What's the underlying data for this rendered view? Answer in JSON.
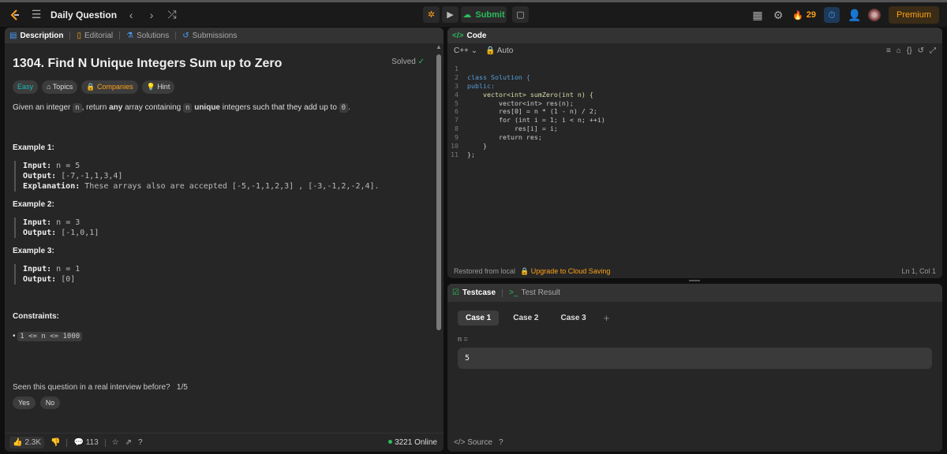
{
  "nav": {
    "title": "Daily Question",
    "submit_label": "Submit",
    "streak": "29",
    "premium_label": "Premium"
  },
  "desc_tabs": [
    "Description",
    "Editorial",
    "Solutions",
    "Submissions"
  ],
  "problem": {
    "title": "1304. Find N Unique Integers Sum up to Zero",
    "solved": "Solved",
    "chips": [
      "Easy",
      "Topics",
      "Companies",
      "Hint"
    ],
    "stmt": {
      "p1": "Given an integer ",
      "c1": "n",
      "p2": ", return ",
      "b1": "any",
      "p3": " array containing ",
      "c2": "n",
      "p4": " ",
      "b2": "unique",
      "p5": " integers such that they add up to ",
      "c3": "0",
      "p6": "."
    },
    "examples": [
      {
        "h": "Example 1:",
        "input_label": "Input:",
        "input": "n = 5",
        "output_label": "Output:",
        "output": "[-7,-1,1,3,4]",
        "expl_label": "Explanation:",
        "expl": "These arrays also are accepted [-5,-1,1,2,3] , [-3,-1,2,-2,4]."
      },
      {
        "h": "Example 2:",
        "input_label": "Input:",
        "input": "n = 3",
        "output_label": "Output:",
        "output": "[-1,0,1]"
      },
      {
        "h": "Example 3:",
        "input_label": "Input:",
        "input": "n = 1",
        "output_label": "Output:",
        "output": "[0]"
      }
    ],
    "constraints_h": "Constraints:",
    "constraint": "1 <= n <= 1000",
    "seen": "Seen this question in a real interview before?",
    "seen_count": "1/5",
    "yes": "Yes",
    "no": "No"
  },
  "desc_footer": {
    "likes": "2.3K",
    "comments": "113",
    "online": "3221 Online"
  },
  "code": {
    "tab": "Code",
    "lang": "C++",
    "auto": "Auto",
    "lines": [
      "",
      "class Solution {",
      "public:",
      "    vector<int> sumZero(int n) {",
      "        vector<int> res(n);",
      "        res[0] = n * (1 - n) / 2;",
      "        for (int i = 1; i < n; ++i)",
      "            res[i] = i;",
      "        return res;",
      "    }",
      "};"
    ],
    "restored": "Restored from local",
    "upgrade": "Upgrade to Cloud Saving",
    "position": "Ln 1, Col 1"
  },
  "test": {
    "tab1": "Testcase",
    "tab2": "Test Result",
    "cases": [
      "Case 1",
      "Case 2",
      "Case 3"
    ],
    "label": "n =",
    "value": "5",
    "source": "Source"
  },
  "colors": {
    "accent": "#ffa116",
    "green": "#2cbb5d",
    "easy": "#1cbaba"
  }
}
